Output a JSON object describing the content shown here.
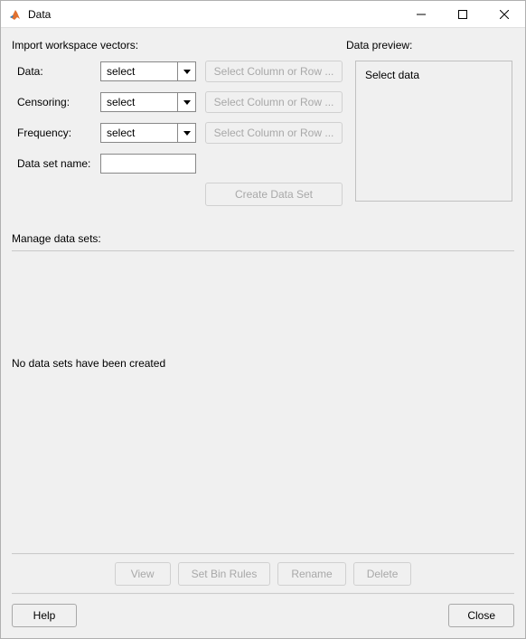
{
  "window": {
    "title": "Data"
  },
  "import": {
    "header": "Import workspace vectors:",
    "rows": {
      "data": {
        "label": "Data:",
        "select_value": "select",
        "col_btn": "Select Column or Row ..."
      },
      "censoring": {
        "label": "Censoring:",
        "select_value": "select",
        "col_btn": "Select Column or Row ..."
      },
      "frequency": {
        "label": "Frequency:",
        "select_value": "select",
        "col_btn": "Select Column or Row ..."
      },
      "datasetname": {
        "label": "Data set name:",
        "value": ""
      }
    },
    "create_btn": "Create Data Set"
  },
  "preview": {
    "header": "Data preview:",
    "body": "Select data"
  },
  "manage": {
    "header": "Manage data sets:",
    "empty_text": "No data sets have been created",
    "buttons": {
      "view": "View",
      "setbinrules": "Set Bin Rules",
      "rename": "Rename",
      "delete": "Delete"
    }
  },
  "bottom": {
    "help": "Help",
    "close": "Close"
  }
}
